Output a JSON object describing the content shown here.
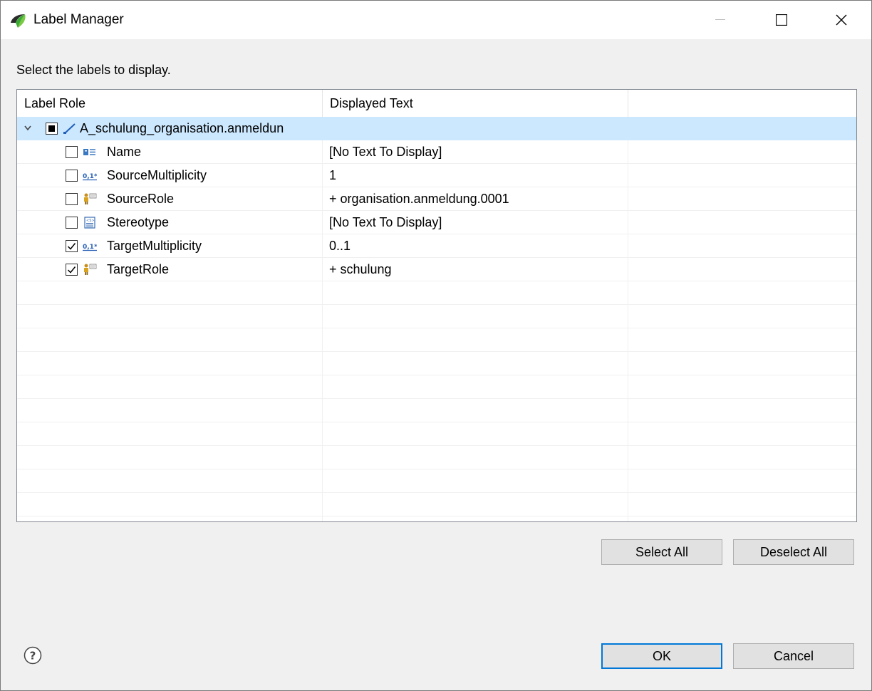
{
  "window": {
    "title": "Label Manager",
    "prompt": "Select the labels to display."
  },
  "table": {
    "columns": [
      "Label Role",
      "Displayed Text",
      ""
    ],
    "root": {
      "label": "A_schulung_organisation.anmeldun",
      "state": "partial",
      "expanded": true
    },
    "rows": [
      {
        "label": "Name",
        "text": "[No Text To Display]",
        "checked": false,
        "icon": "name-icon"
      },
      {
        "label": "SourceMultiplicity",
        "text": "1",
        "checked": false,
        "icon": "multiplicity-icon"
      },
      {
        "label": "SourceRole",
        "text": "+ organisation.anmeldung.0001",
        "checked": false,
        "icon": "role-icon"
      },
      {
        "label": "Stereotype",
        "text": "[No Text To Display]",
        "checked": false,
        "icon": "stereotype-icon"
      },
      {
        "label": "TargetMultiplicity",
        "text": "0..1",
        "checked": true,
        "icon": "multiplicity-icon"
      },
      {
        "label": "TargetRole",
        "text": "+ schulung",
        "checked": true,
        "icon": "role-icon"
      }
    ]
  },
  "buttons": {
    "select_all": "Select All",
    "deselect_all": "Deselect All",
    "ok": "OK",
    "cancel": "Cancel"
  },
  "colors": {
    "selection": "#cce8ff",
    "accent": "#0078d7"
  }
}
